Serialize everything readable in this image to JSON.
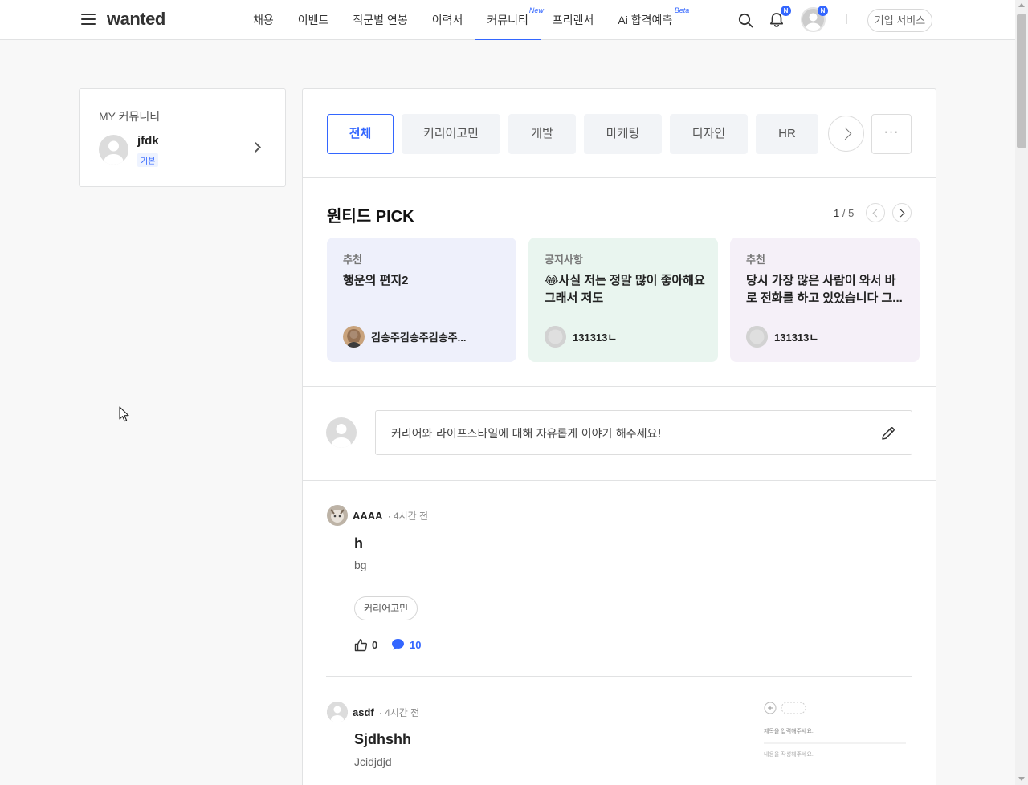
{
  "header": {
    "logo": "wanted",
    "nav": [
      {
        "label": "채용",
        "sup": ""
      },
      {
        "label": "이벤트",
        "sup": ""
      },
      {
        "label": "직군별 연봉",
        "sup": ""
      },
      {
        "label": "이력서",
        "sup": ""
      },
      {
        "label": "커뮤니티",
        "sup": "New"
      },
      {
        "label": "프리랜서",
        "sup": ""
      },
      {
        "label": "Ai 합격예측",
        "sup": "Beta"
      }
    ],
    "badge": "N",
    "business_button": "기업 서비스"
  },
  "my_community": {
    "title": "MY 커뮤니티",
    "username": "jfdk",
    "tier": "기본"
  },
  "categories": [
    "전체",
    "커리어고민",
    "개발",
    "마케팅",
    "디자인",
    "HR"
  ],
  "more_label": "···",
  "pick": {
    "title": "원티드 PICK",
    "page_current": "1",
    "page_total": "/ 5",
    "cards": [
      {
        "category": "추천",
        "title": "행운의 편지2",
        "author": "김승주김승주김승주...",
        "bg": "#eef0fb"
      },
      {
        "category": "공지사항",
        "title": "😂사실 저는 정말 많이 좋아해요 그래서 저도",
        "author": "131313ㄴ",
        "bg": "#e9f5ef"
      },
      {
        "category": "추천",
        "title": "당시 가장 많은 사람이 와서 바로 전화를 하고 있었습니다 그...",
        "author": "131313ㄴ",
        "bg": "#f5f0f8"
      }
    ]
  },
  "composer": {
    "placeholder": "커리어와 라이프스타일에 대해 자유롭게 이야기 해주세요!"
  },
  "posts": [
    {
      "author": "AAAA",
      "time": "4시간 전",
      "title": "h",
      "body": "bg",
      "tag": "커리어고민",
      "likes": "0",
      "comments": "10"
    },
    {
      "author": "asdf",
      "time": "4시간 전",
      "title": "Sjdhshh",
      "body": "Jcidjdjd",
      "thumb_lines": [
        "제목을 입력해주세요.",
        "내용을 작성해주세요."
      ]
    }
  ],
  "colors": {
    "accent": "#3366ff"
  }
}
